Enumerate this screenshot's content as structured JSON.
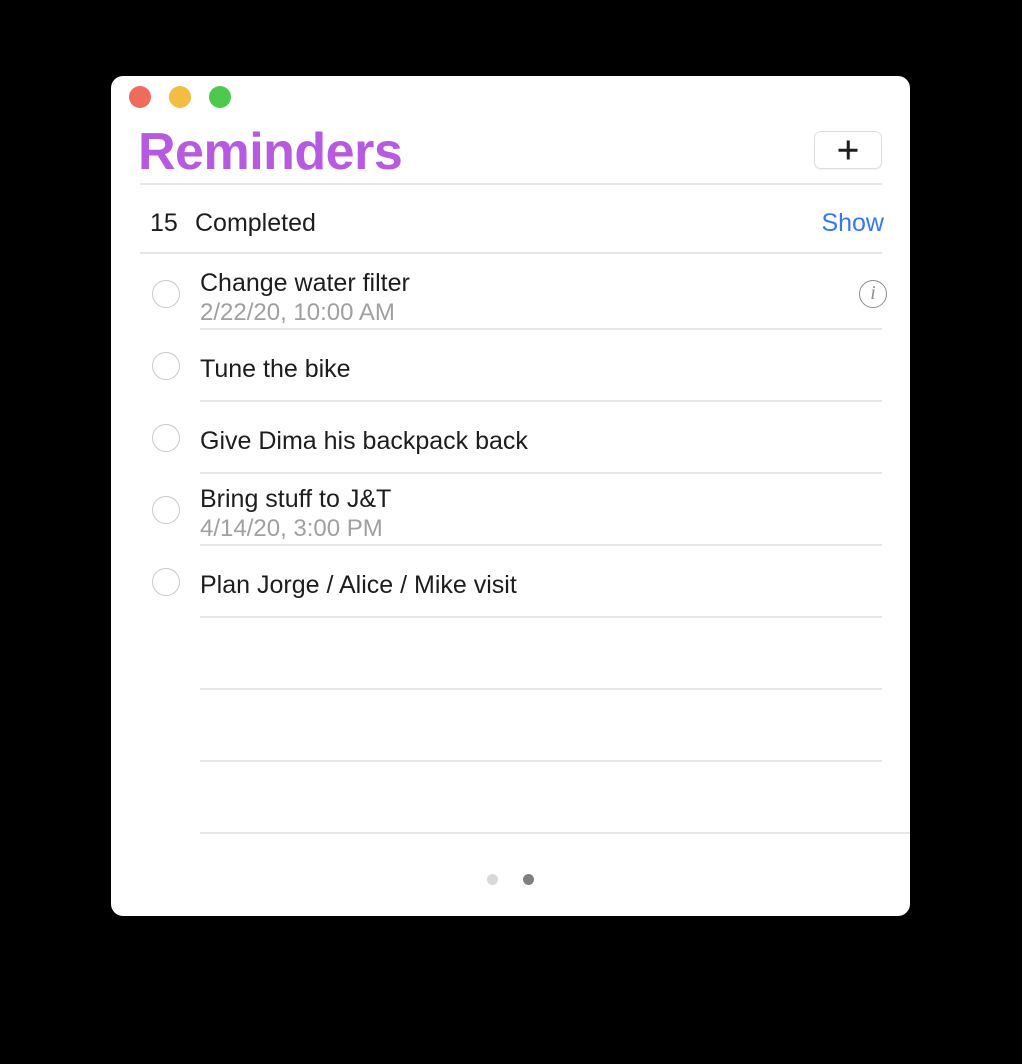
{
  "window": {
    "title": "Reminders",
    "title_color": "#b85ae0",
    "traffic_lights": [
      {
        "name": "close",
        "color": "#ef6b5c"
      },
      {
        "name": "minimize",
        "color": "#f2bd42"
      },
      {
        "name": "maximize",
        "color": "#4dc94d"
      }
    ]
  },
  "toolbar": {
    "add_icon": "plus-icon",
    "add_label": ""
  },
  "completed": {
    "count": "15",
    "label": "Completed",
    "show_label": "Show",
    "show_color": "#3478f6"
  },
  "reminders": [
    {
      "title": "Change water filter",
      "date": "2/22/20, 10:00 AM",
      "has_info": true,
      "checked": false
    },
    {
      "title": "Tune the bike",
      "date": "",
      "has_info": false,
      "checked": false
    },
    {
      "title": "Give Dima his backpack back",
      "date": "",
      "has_info": false,
      "checked": false
    },
    {
      "title": "Bring stuff to J&T",
      "date": "4/14/20, 3:00 PM",
      "has_info": false,
      "checked": false
    },
    {
      "title": "Plan Jorge / Alice / Mike visit",
      "date": "",
      "has_info": false,
      "checked": false
    }
  ],
  "empty_rows": 3,
  "pagination": {
    "dots": [
      {
        "active": false,
        "color": "#d8d8d8"
      },
      {
        "active": true,
        "color": "#808080"
      }
    ]
  }
}
